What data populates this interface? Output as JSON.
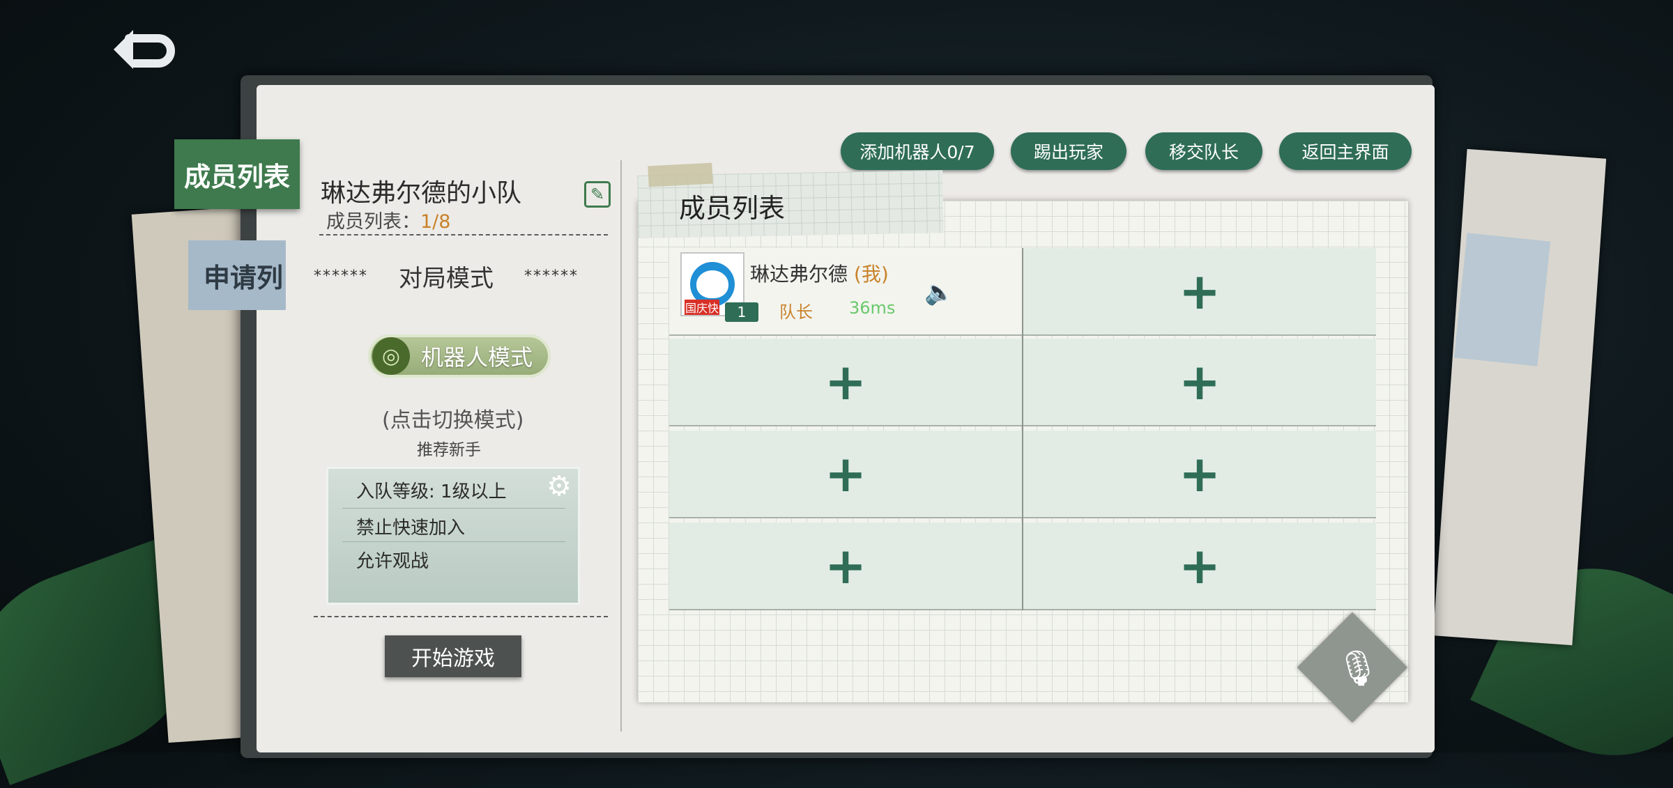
{
  "tabs": {
    "members": "成员列表",
    "apply": "申请列"
  },
  "team": {
    "title": "琳达弗尔德的小队",
    "member_count_label": "成员列表：",
    "member_count_value": "1/8"
  },
  "mode": {
    "stars_left": "******",
    "label": "对局模式",
    "stars_right": "******",
    "robot_mode": "机器人模式",
    "switch_hint": "(点击切换模式)",
    "recommend": "推荐新手"
  },
  "settings": {
    "level": "入队等级:   1级以上",
    "no_quick_join": "禁止快速加入",
    "allow_spectate": "允许观战"
  },
  "start_button": "开始游戏",
  "top_buttons": {
    "add_robot": "添加机器人0/7",
    "kick": "踢出玩家",
    "transfer": "移交队长",
    "back_main": "返回主界面"
  },
  "board": {
    "title": "成员列表",
    "member": {
      "name": "琳达弗尔德",
      "me_tag": "(我)",
      "badge": "国庆快",
      "level": "1",
      "role": "队长",
      "ping": "36ms"
    },
    "empty_plus": "+"
  },
  "colors": {
    "accent_green": "#2f6d57",
    "tab_green": "#3e7a4d",
    "orange": "#c9822b",
    "ping_green": "#69c96c"
  },
  "icons": {
    "back": "back-arrow-icon",
    "edit": "edit-icon",
    "gear": "gear-icon",
    "speaker": "speaker-icon",
    "mic": "microphone-icon"
  }
}
